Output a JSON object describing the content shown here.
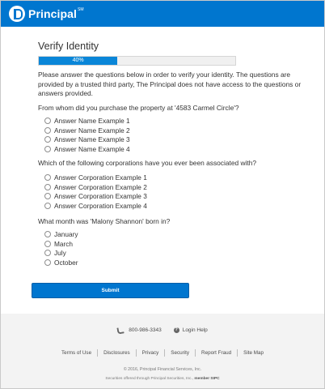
{
  "brand": {
    "name": "Principal",
    "trademark": "SM"
  },
  "page": {
    "title": "Verify Identity",
    "progress": {
      "percent": 40,
      "label": "40%"
    },
    "intro": "Please answer the questions below in order to verify your identity. The questions are provided by a trusted third party, The Principal does not have access to the questions or answers provided."
  },
  "questions": [
    {
      "text": "From whom did you purchase the property at '4583 Carmel Circle'?",
      "options": [
        "Answer Name Example 1",
        "Answer Name Example 2",
        "Answer Name Example 3",
        "Answer Name Example 4"
      ]
    },
    {
      "text": "Which of the following corporations have you ever been associated with?",
      "options": [
        "Answer Corporation Example 1",
        "Answer Corporation Example 2",
        "Answer Corporation Example 3",
        "Answer Corporation Example 4"
      ]
    },
    {
      "text": "What month was 'Malony Shannon' born in?",
      "options": [
        "January",
        "March",
        "July",
        "October"
      ]
    }
  ],
  "submit_label": "Submit",
  "footer": {
    "phone": "800-986-3343",
    "login_help": "Login Help",
    "links": [
      "Terms of Use",
      "Disclosures",
      "Privacy",
      "Security",
      "Report Fraud",
      "Site Map"
    ],
    "copyright": "© 2016, Principal Financial Services, Inc.",
    "securities_text": "Securities offered through Principal Securities, Inc.,",
    "securities_member": "member SIPC"
  },
  "colors": {
    "brand_blue": "#0076cf",
    "progress_fill": "#0a86d8",
    "footer_bg": "#f3f3f3"
  },
  "icons": {
    "logo": "principal-logo-mark",
    "phone": "phone-icon",
    "help": "help-icon"
  }
}
